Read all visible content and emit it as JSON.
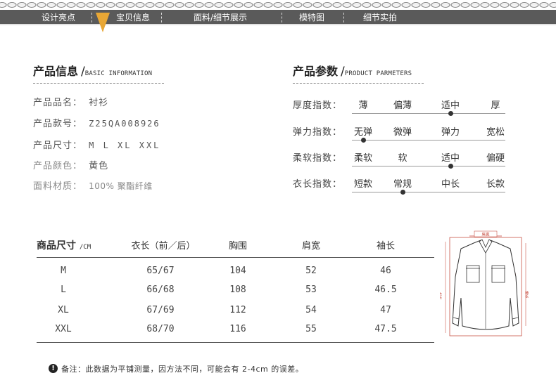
{
  "nav": {
    "items": [
      "设计亮点",
      "宝贝信息",
      "面料/细节展示",
      "模特图",
      "细节实拍"
    ],
    "active_index": 1,
    "accent_color": "#e8a735",
    "bar_color": "#5a5a5a"
  },
  "product_info": {
    "title": "产品信息",
    "subtitle": "BASIC INFORMATION",
    "rows": [
      {
        "label": "产品品名：",
        "value": "衬衫"
      },
      {
        "label": "产品款号：",
        "value": "Z25QA008926"
      },
      {
        "label": "产品尺寸：",
        "value": "M L XL XXL"
      },
      {
        "label": "产品颜色：",
        "value": "黄色"
      },
      {
        "label": "面料材质：",
        "value": "100% 聚酯纤维"
      }
    ]
  },
  "product_params": {
    "title": "产品参数",
    "subtitle": "PRODUCT PARMETERS",
    "rows": [
      {
        "label": "厚度指数：",
        "options": [
          "薄",
          "偏薄",
          "适中",
          "厚"
        ],
        "selected": 2
      },
      {
        "label": "弹力指数：",
        "options": [
          "无弹",
          "微弹",
          "弹力",
          "宽松"
        ],
        "selected": 0
      },
      {
        "label": "柔软指数：",
        "options": [
          "柔软",
          "软",
          "适中",
          "偏硬"
        ],
        "selected": 2
      },
      {
        "label": "衣长指数：",
        "options": [
          "短款",
          "常规",
          "中长",
          "长款"
        ],
        "selected": 1
      }
    ]
  },
  "size_table": {
    "headers": [
      "商品尺寸",
      "衣长（前／后）",
      "胸围",
      "肩宽",
      "袖长"
    ],
    "unit": "/CM",
    "rows": [
      [
        "M",
        "65/67",
        "104",
        "52",
        "46"
      ],
      [
        "L",
        "66/68",
        "108",
        "53",
        "46.5"
      ],
      [
        "XL",
        "67/69",
        "112",
        "54",
        "47"
      ],
      [
        "XXL",
        "68/70",
        "116",
        "55",
        "47.5"
      ]
    ]
  },
  "diagram": {
    "labels": {
      "shoulder": "肩宽",
      "chest": "胸围",
      "length": "衣长",
      "sleeve": "袖长"
    },
    "measure_color": "#c0392b"
  },
  "note": {
    "icon": "exclamation-icon",
    "text": "备注：此数据为平铺测量，因方法不同，可能会有 2-4cm 的误差。"
  }
}
